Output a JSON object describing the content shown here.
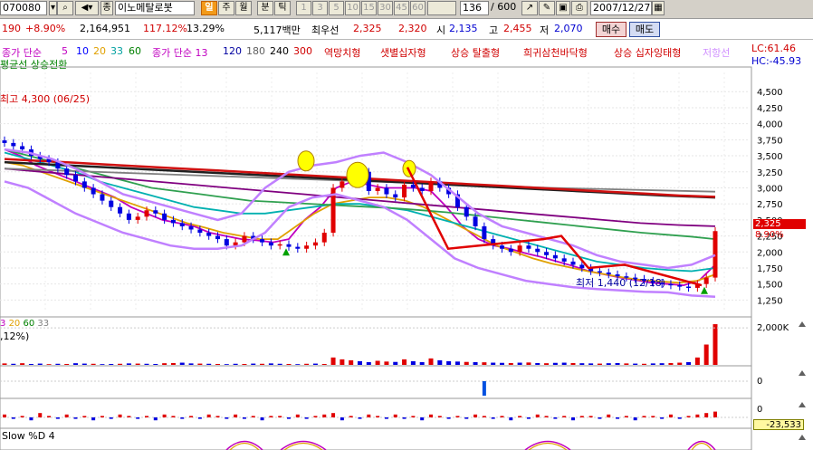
{
  "toolbar": {
    "stock_code": "070080",
    "category_label": "종",
    "stock_name": "이노메탈로봇",
    "period_buttons": [
      "일",
      "주",
      "월",
      "분",
      "틱"
    ],
    "minute_buttons": [
      "1",
      "3",
      "5",
      "10",
      "15",
      "30",
      "45",
      "60"
    ],
    "count_value": "136",
    "count_total": "/ 600",
    "date": "2007/12/27"
  },
  "info": {
    "price_part": "190",
    "change_pct": "+8.90%",
    "volume": "2,164,951",
    "volume_ratio": "117.12%",
    "turnover": "13.29%",
    "amount": "5,117백만",
    "best_label": "최우선",
    "best_ask": "2,325",
    "best_bid": "2,320",
    "open_label": "시",
    "open": "2,135",
    "high_label": "고",
    "high": "2,455",
    "low_label": "저",
    "low": "2,070",
    "buy_button": "매수",
    "sell_button": "매도"
  },
  "legend": {
    "items": [
      {
        "text": "종가 단순",
        "color": "#c000c0"
      },
      {
        "text": "5",
        "color": "#c000c0"
      },
      {
        "text": "10",
        "color": "#0000ff"
      },
      {
        "text": "20",
        "color": "#e0a000"
      },
      {
        "text": "33",
        "color": "#00a0a0"
      },
      {
        "text": "60",
        "color": "#008000"
      },
      {
        "text": "종가 단순 13",
        "color": "#c000c0"
      },
      {
        "text": "120",
        "color": "#0000a0"
      },
      {
        "text": "180",
        "color": "#606060"
      },
      {
        "text": "240",
        "color": "#000000"
      },
      {
        "text": "300",
        "color": "#d00000"
      },
      {
        "text": "역망치형",
        "color": "#d00000"
      },
      {
        "text": "샛별십자형",
        "color": "#d00000"
      },
      {
        "text": "상승 탈출형",
        "color": "#d00000"
      },
      {
        "text": "희귀삼천바닥형",
        "color": "#d00000"
      },
      {
        "text": "상승 십자잉태형",
        "color": "#d00000"
      },
      {
        "text": "저항선",
        "color": "#d090ff"
      }
    ],
    "line2": "평균선 상승전환",
    "lc": "LC:61.46",
    "hc": "HC:-45.93"
  },
  "chart_data": [
    {
      "type": "candlestick",
      "title": "",
      "y_ticks": [
        4500,
        4250,
        4000,
        3750,
        3500,
        3250,
        3000,
        2750,
        2500,
        2250,
        2000,
        1750,
        1500,
        1250
      ],
      "ylim": [
        1100,
        4800
      ],
      "current_price": "2,325",
      "current_change": "8.90%",
      "annotations": {
        "high": "최고 4,300 (06/25)",
        "low": "최저 1,440 (12/18)"
      },
      "close_series": [
        3700,
        3650,
        3600,
        3500,
        3450,
        3400,
        3300,
        3200,
        3100,
        3000,
        2900,
        2800,
        2700,
        2600,
        2500,
        2550,
        2650,
        2600,
        2500,
        2450,
        2400,
        2350,
        2300,
        2250,
        2200,
        2100,
        2150,
        2250,
        2200,
        2150,
        2100,
        2120,
        2080,
        2050,
        2100,
        2150,
        2300,
        3000,
        3100,
        3200,
        3250,
        2950,
        3000,
        2900,
        2850,
        3050,
        3000,
        2950,
        3100,
        3000,
        2900,
        2700,
        2550,
        2400,
        2200,
        2100,
        2050,
        2000,
        2100,
        2050,
        2000,
        1950,
        1900,
        1850,
        1800,
        1750,
        1700,
        1680,
        1650,
        1620,
        1600,
        1580,
        1550,
        1520,
        1500,
        1480,
        1460,
        1440,
        1500,
        1600,
        2325
      ],
      "ma_series": [
        {
          "name": "5",
          "color": "#c000c0",
          "values": [
            3600,
            3500,
            3350,
            3250,
            3150,
            3050,
            2950,
            2850,
            2700,
            2600,
            2500,
            2450,
            2400,
            2300,
            2250,
            2200,
            2180,
            2150,
            2200,
            2500,
            2700,
            3000,
            3100,
            3050,
            3000,
            3000,
            3000,
            2950,
            2700,
            2400,
            2200,
            2100,
            2050,
            1980,
            1920,
            1850,
            1780,
            1700,
            1650,
            1600,
            1560,
            1520,
            1500,
            1480,
            1560,
            1800
          ]
        },
        {
          "name": "20",
          "color": "#e0a000",
          "values": [
            3400,
            3350,
            3250,
            3150,
            3050,
            2950,
            2850,
            2750,
            2650,
            2550,
            2450,
            2380,
            2300,
            2250,
            2200,
            2200,
            2400,
            2600,
            2750,
            2800,
            2850,
            2850,
            2800,
            2700,
            2550,
            2400,
            2250,
            2100,
            2000,
            1900,
            1820,
            1760,
            1700,
            1650,
            1600,
            1560,
            1540,
            1520,
            1550,
            1650
          ]
        },
        {
          "name": "33",
          "color": "#00b0b0",
          "values": [
            3550,
            3450,
            3350,
            3250,
            3100,
            3000,
            2900,
            2800,
            2700,
            2650,
            2600,
            2600,
            2650,
            2700,
            2750,
            2750,
            2700,
            2650,
            2550,
            2450,
            2350,
            2250,
            2150,
            2050,
            1950,
            1850,
            1800,
            1750,
            1720,
            1700,
            1750
          ]
        },
        {
          "name": "60",
          "color": "#30a050",
          "values": [
            3600,
            3500,
            3400,
            3300,
            3200,
            3100,
            3000,
            2950,
            2900,
            2850,
            2800,
            2780,
            2760,
            2740,
            2720,
            2700,
            2680,
            2650,
            2620,
            2580,
            2540,
            2500,
            2460,
            2420,
            2380,
            2340,
            2300,
            2270,
            2240,
            2200
          ]
        },
        {
          "name": "120",
          "color": "#800080",
          "values": [
            3300,
            3250,
            3200,
            3150,
            3100,
            3050,
            3000,
            2950,
            2900,
            2850,
            2800,
            2750,
            2700,
            2650,
            2600,
            2550,
            2500,
            2450,
            2420,
            2400
          ]
        },
        {
          "name": "180",
          "color": "#808080",
          "values": [
            3300,
            3270,
            3240,
            3210,
            3180,
            3150,
            3120,
            3090,
            3060,
            3030,
            3000,
            2980,
            2960,
            2940
          ]
        },
        {
          "name": "240",
          "color": "#202020",
          "values": [
            3400,
            3360,
            3320,
            3280,
            3240,
            3200,
            3160,
            3120,
            3080,
            3040,
            3000,
            2960,
            2920,
            2880,
            2850
          ]
        },
        {
          "name": "300",
          "color": "#d01010",
          "values": [
            3450,
            3420,
            3390,
            3360,
            3330,
            3300,
            3270,
            3240,
            3210,
            3180,
            3150,
            3120,
            3090,
            3060,
            3030,
            3000,
            2970,
            2940,
            2910,
            2880,
            2860
          ]
        }
      ]
    },
    {
      "type": "bar",
      "title": "",
      "legend": [
        "3",
        "20",
        "60",
        "33"
      ],
      "legend_colors": [
        "#c000c0",
        "#e0a000",
        "#008000",
        "#808080"
      ],
      "label": ",12%)",
      "y_ticks": [
        2000
      ],
      "y_tick_label": "2,000K",
      "ylim": [
        0,
        2300
      ],
      "values": [
        80,
        60,
        90,
        50,
        70,
        40,
        60,
        50,
        90,
        70,
        60,
        40,
        50,
        60,
        80,
        70,
        60,
        50,
        90,
        100,
        120,
        80,
        70,
        60,
        50,
        40,
        60,
        50,
        70,
        60,
        80,
        60,
        50,
        40,
        60,
        70,
        50,
        400,
        300,
        250,
        200,
        150,
        220,
        180,
        160,
        300,
        200,
        150,
        350,
        250,
        200,
        180,
        160,
        150,
        140,
        120,
        110,
        100,
        120,
        130,
        100,
        90,
        110,
        120,
        100,
        90,
        80,
        70,
        90,
        100,
        80,
        70,
        60,
        80,
        90,
        100,
        120,
        150,
        400,
        1100,
        2200
      ],
      "signs": [
        1,
        0,
        1,
        0,
        0,
        1,
        0,
        1,
        0,
        0,
        1,
        0,
        0,
        1,
        0,
        1,
        0,
        0,
        1,
        1,
        0,
        0,
        1,
        0,
        1,
        0,
        0,
        1,
        0,
        1,
        0,
        0,
        1,
        0,
        1,
        0,
        1,
        1,
        1,
        1,
        0,
        0,
        1,
        1,
        0,
        1,
        0,
        0,
        1,
        0,
        0,
        0,
        1,
        0,
        1,
        0,
        0,
        1,
        0,
        1,
        0,
        1,
        0,
        0,
        1,
        0,
        0,
        1,
        0,
        0,
        1,
        0,
        1,
        0,
        0,
        1,
        1,
        0,
        1,
        1,
        1
      ]
    },
    {
      "type": "bar",
      "title": "",
      "y_ticks": [
        0
      ],
      "y_tick_label": "0",
      "values": [
        0,
        0,
        0,
        0,
        0,
        0,
        0,
        0,
        0,
        0,
        0,
        0,
        0,
        0,
        0,
        0,
        0,
        0,
        0,
        0,
        0,
        0,
        0,
        0,
        0,
        0,
        0,
        0,
        0,
        0,
        0,
        0,
        0,
        0,
        0,
        0,
        0,
        0,
        0,
        0,
        0,
        0,
        0,
        0,
        0,
        0,
        0,
        0,
        0,
        0,
        0,
        0,
        0,
        0,
        -1,
        0,
        0,
        0,
        0,
        0,
        0,
        0,
        0,
        0,
        0,
        0,
        0,
        0,
        0,
        0,
        0,
        0,
        0,
        0,
        0,
        0,
        0,
        0,
        0,
        0,
        0
      ]
    },
    {
      "type": "bar",
      "title": "",
      "y_ticks": [
        0
      ],
      "y_tick_label": "0",
      "current_value": "-23,533",
      "values": [
        2,
        -1,
        1,
        -2,
        3,
        1,
        -1,
        2,
        -1,
        1,
        -2,
        1,
        -1,
        2,
        1,
        -1,
        1,
        -2,
        2,
        1,
        -1,
        1,
        -1,
        2,
        1,
        -1,
        2,
        -1,
        1,
        -2,
        1,
        1,
        -1,
        2,
        -1,
        1,
        2,
        3,
        -2,
        1,
        -1,
        2,
        1,
        -1,
        2,
        -1,
        1,
        -2,
        2,
        1,
        -1,
        1,
        -1,
        2,
        1,
        -1,
        1,
        -2,
        1,
        -1,
        2,
        1,
        -1,
        1,
        -2,
        1,
        1,
        -1,
        2,
        -1,
        1,
        -2,
        1,
        1,
        -1,
        2,
        -1,
        1,
        2,
        3,
        4
      ]
    },
    {
      "type": "line",
      "title": "",
      "label": "Slow %D 4"
    }
  ]
}
